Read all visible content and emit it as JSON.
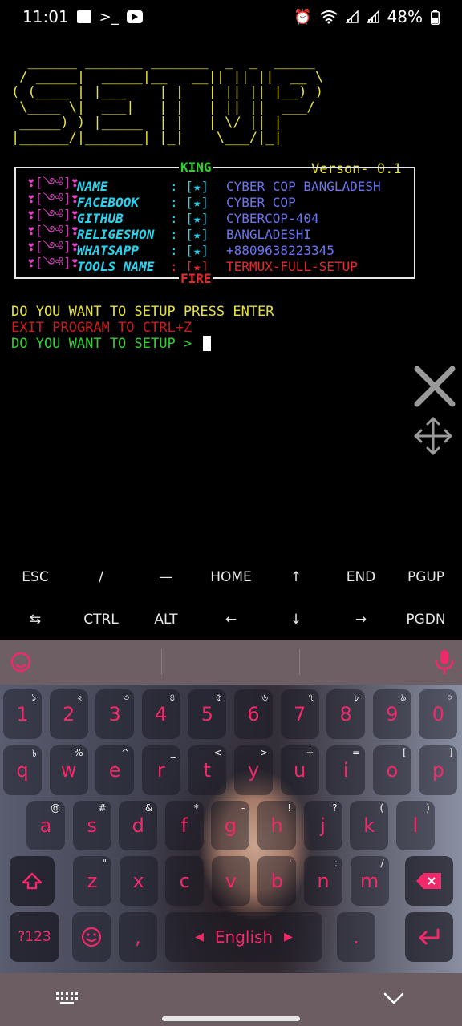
{
  "status_bar": {
    "time": "11:01",
    "battery": "48%"
  },
  "terminal": {
    "banner_art": "  ______ _______ _______  _  _  _____\n / _____|  _____|__   __|| || ||  __ \\\n( (____ | |___    | |   | || || |__) )\n \\____ \\|  ___|   | |   | || ||  ___/\n _____) ) |_____  | |   | \\/ || |\n|______/|_______| |_|    \\___/|_|",
    "version": "Verson- 0.1",
    "box_top_label": "KING",
    "box_bottom_label": "FIRE",
    "rows": [
      {
        "prefix": "❣[༺]❣",
        "label": "NAME",
        "sep": ": [★]",
        "value": "CYBER COP BANGLADESH"
      },
      {
        "prefix": "❣[༺]❣",
        "label": "FACEBOOK",
        "sep": ": [★]",
        "value": "CYBER COP"
      },
      {
        "prefix": "❣[༺]❣",
        "label": "GITHUB",
        "sep": ": [★]",
        "value": "CYBERCOP-404"
      },
      {
        "prefix": "❣[༺]❣",
        "label": "RELIGESHON",
        "sep": ": [★]",
        "value": "BANGLADESHI"
      },
      {
        "prefix": "❣[༺]❣",
        "label": "WHATSAPP",
        "sep": ": [★]",
        "value": "+8809638223345"
      },
      {
        "prefix": "❣[༺]❣",
        "label": "TOOLS NAME",
        "sep": ": [★]",
        "value": "TERMUX-FULL-SETUP"
      }
    ],
    "line1": "DO YOU WANT TO SETUP PRESS ENTER",
    "line2": "EXIT PROGRAM TO CTRL+Z",
    "line3": "DO YOU WANT TO SETUP > "
  },
  "extra_keys": {
    "row1": [
      "ESC",
      "/",
      "—",
      "HOME",
      "↑",
      "END",
      "PGUP"
    ],
    "row2": [
      "⇆",
      "CTRL",
      "ALT",
      "←",
      "↓",
      "→",
      "PGDN"
    ]
  },
  "keyboard": {
    "row_numbers": [
      {
        "k": "1",
        "h": "১"
      },
      {
        "k": "2",
        "h": "২"
      },
      {
        "k": "3",
        "h": "৩"
      },
      {
        "k": "4",
        "h": "৪"
      },
      {
        "k": "5",
        "h": "৫"
      },
      {
        "k": "6",
        "h": "৬"
      },
      {
        "k": "7",
        "h": "৭"
      },
      {
        "k": "8",
        "h": "৮"
      },
      {
        "k": "9",
        "h": "৯"
      },
      {
        "k": "0",
        "h": "০"
      }
    ],
    "row_q": [
      {
        "k": "q",
        "h": "৳"
      },
      {
        "k": "w",
        "h": "%"
      },
      {
        "k": "e",
        "h": "^"
      },
      {
        "k": "r",
        "h": "_"
      },
      {
        "k": "t",
        "h": "<"
      },
      {
        "k": "y",
        "h": ">"
      },
      {
        "k": "u",
        "h": "+"
      },
      {
        "k": "i",
        "h": "="
      },
      {
        "k": "o",
        "h": "["
      },
      {
        "k": "p",
        "h": "]"
      }
    ],
    "row_a": [
      {
        "k": "a",
        "h": "@"
      },
      {
        "k": "s",
        "h": "#"
      },
      {
        "k": "d",
        "h": "&"
      },
      {
        "k": "f",
        "h": "*"
      },
      {
        "k": "g",
        "h": "-"
      },
      {
        "k": "h",
        "h": "!"
      },
      {
        "k": "j",
        "h": "?"
      },
      {
        "k": "k",
        "h": "("
      },
      {
        "k": "l",
        "h": ")"
      }
    ],
    "row_z": [
      {
        "k": "z",
        "h": "\""
      },
      {
        "k": "x",
        "h": ""
      },
      {
        "k": "c",
        "h": ""
      },
      {
        "k": "v",
        "h": ""
      },
      {
        "k": "b",
        "h": "'"
      },
      {
        "k": "n",
        "h": ":"
      },
      {
        "k": "m",
        "h": "/"
      }
    ],
    "symbols_label": "?123",
    "comma": ",",
    "space_label": "English",
    "period": "."
  },
  "colors": {
    "accent": "#f02a6a",
    "terminal_yellow": "#e6e23a",
    "terminal_green": "#2fd12f",
    "terminal_red": "#e42b2b"
  }
}
